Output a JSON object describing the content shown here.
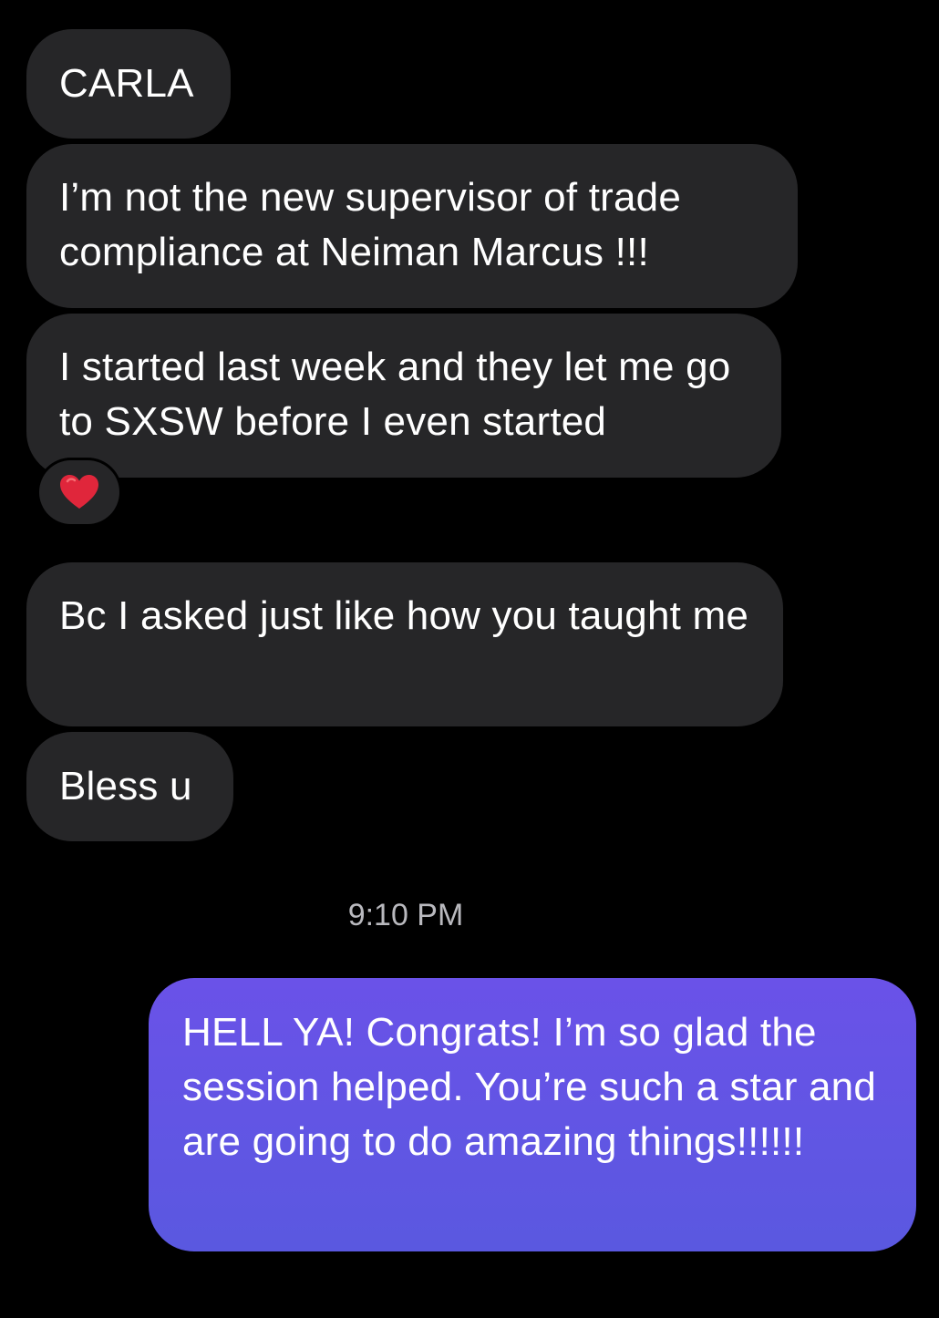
{
  "thread": {
    "incoming": [
      {
        "text": "CARLA"
      },
      {
        "text": "I’m not the new supervisor of trade compliance at Neiman Marcus !!!"
      },
      {
        "text": "I started last week and they let me go to SXSW before I even started"
      },
      {
        "text": "Bc I asked just like how you taught me"
      },
      {
        "text": "Bless u"
      }
    ],
    "reaction": {
      "icon": "heart-icon",
      "color": "#e0263b"
    },
    "timestamp": "9:10 PM",
    "outgoing": [
      {
        "text": "HELL YA! Congrats! I’m so glad the session helped. You’re such a star and are going to do amazing things!!!!!!"
      }
    ]
  },
  "colors": {
    "background": "#000000",
    "incoming_bubble": "#262628",
    "outgoing_bubble": "#5e56e6",
    "timestamp": "#b9b9be"
  }
}
